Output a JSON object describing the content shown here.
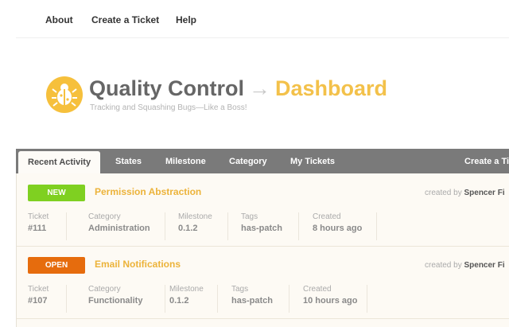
{
  "nav": {
    "about": "About",
    "create_ticket": "Create a Ticket",
    "help": "Help"
  },
  "header": {
    "title_main": "Quality Control",
    "arrow": "→",
    "title_section": "Dashboard",
    "tagline": "Tracking and Squashing Bugs—Like a Boss!"
  },
  "tabs": {
    "recent_activity": "Recent Activity",
    "states": "States",
    "milestone": "Milestone",
    "category": "Category",
    "my_tickets": "My Tickets",
    "create_ticket": "Create a Ti"
  },
  "tickets": [
    {
      "state": "NEW",
      "name": "Permission Abstraction",
      "created_by_label": "created by",
      "created_by": "Spencer Fi",
      "ticket_label": "Ticket",
      "ticket": "#111",
      "category_label": "Category",
      "category": "Administration",
      "milestone_label": "Milestone",
      "milestone": "0.1.2",
      "tags_label": "Tags",
      "tags": "has-patch",
      "created_label": "Created",
      "created": "8 hours ago"
    },
    {
      "state": "OPEN",
      "name": "Email Notifications",
      "created_by_label": "created by",
      "created_by": "Spencer Fi",
      "ticket_label": "Ticket",
      "ticket": "#107",
      "category_label": "Category",
      "category": "Functionality",
      "milestone_label": "Milestone",
      "milestone": "0.1.2",
      "tags_label": "Tags",
      "tags": "has-patch",
      "created_label": "Created",
      "created": "10 hours ago"
    }
  ],
  "colors": {
    "new": "#7fd021",
    "open": "#e66c0d",
    "accent": "#f3c14a",
    "tabbar": "#7a7a7a"
  },
  "icons": {
    "logo": "bug-icon"
  }
}
